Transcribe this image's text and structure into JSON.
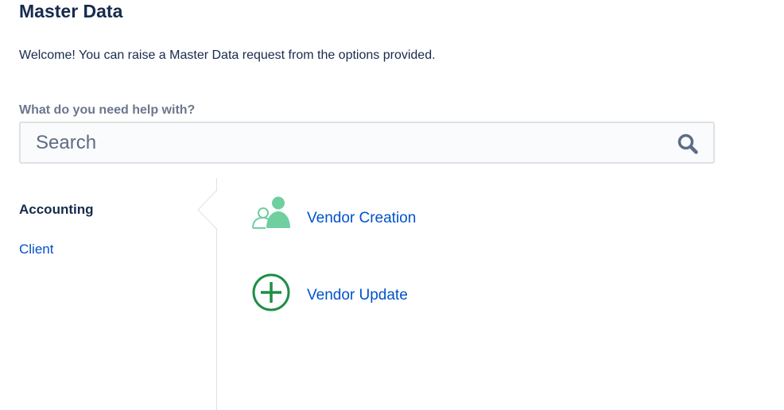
{
  "header": {
    "title": "Master Data",
    "welcome": "Welcome! You can raise a Master Data request from the options provided."
  },
  "search": {
    "label": "What do you need help with?",
    "placeholder": "Search",
    "icon": "search-icon"
  },
  "sidebar": {
    "items": [
      {
        "label": "Accounting",
        "active": true
      },
      {
        "label": "Client",
        "active": false
      }
    ]
  },
  "requests": [
    {
      "label": "Vendor Creation",
      "icon": "users-icon",
      "color": "#6fcf9f"
    },
    {
      "label": "Vendor Update",
      "icon": "plus-circle-icon",
      "color": "#1e8e47"
    }
  ],
  "colors": {
    "text": "#172b4d",
    "link": "#0052cc",
    "muted": "#6b778c",
    "border": "#dfe1e6"
  }
}
